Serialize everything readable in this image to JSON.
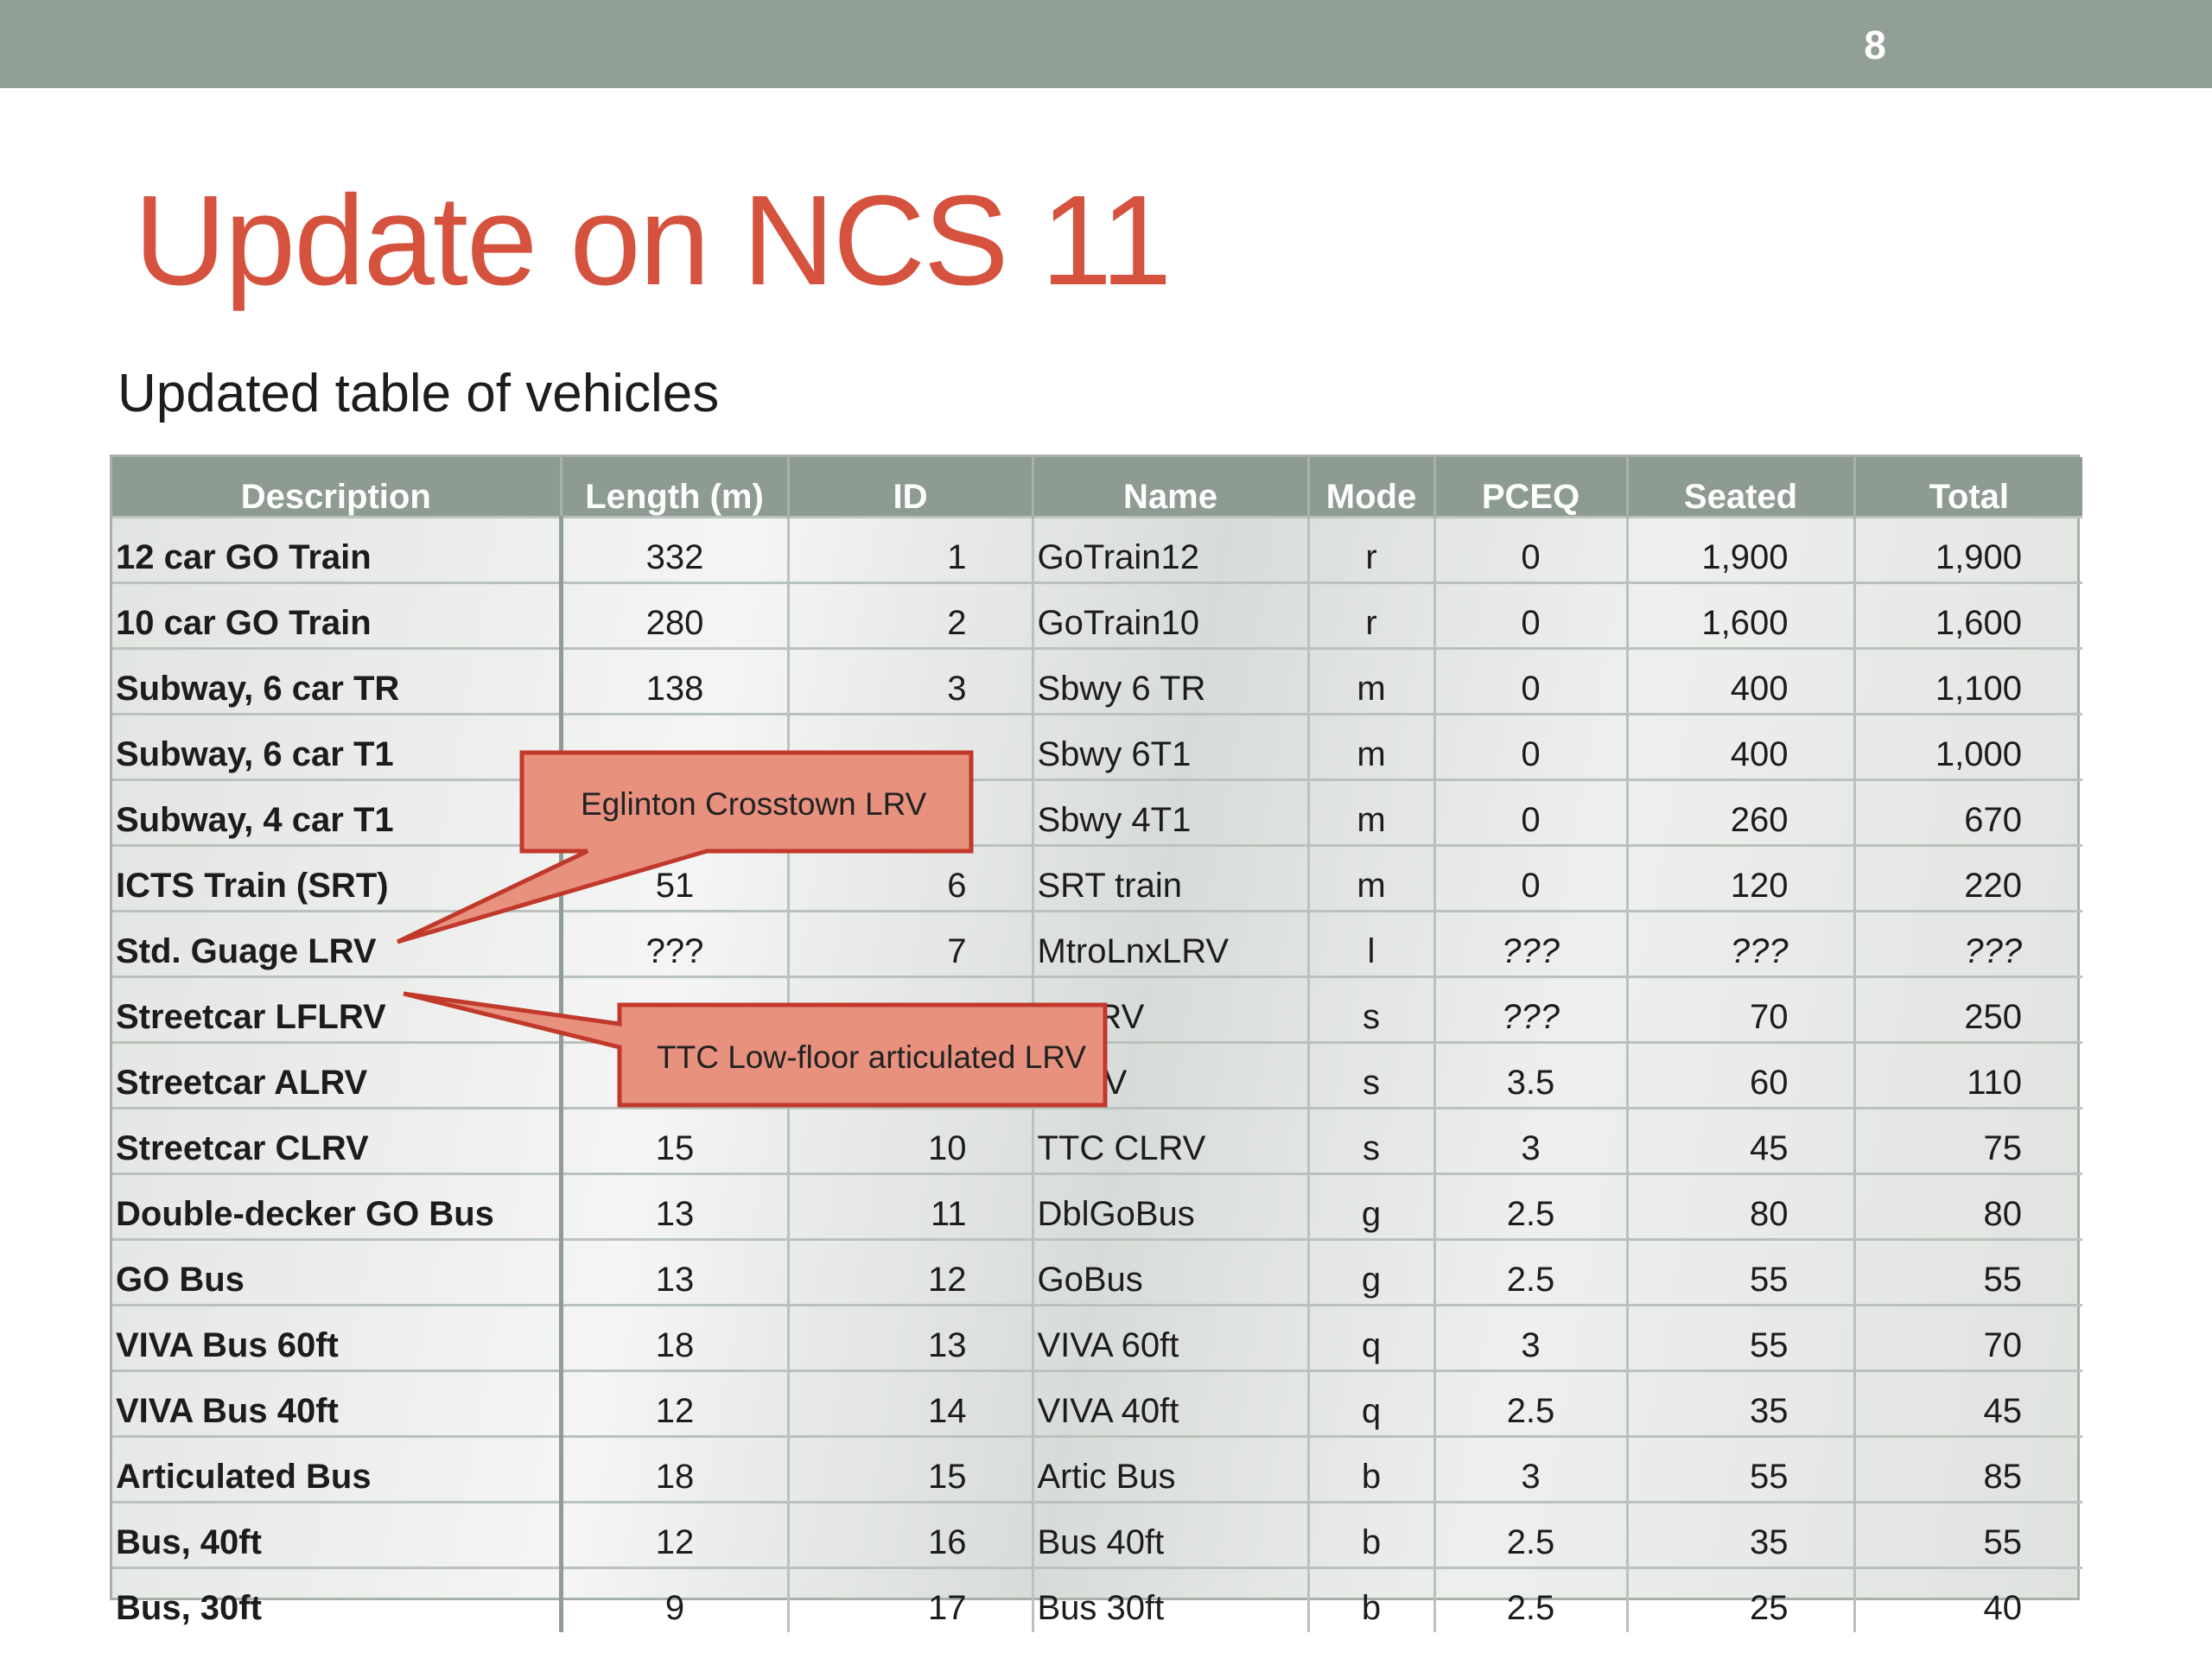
{
  "slide": {
    "page_number": "8",
    "title": "Update on NCS 11",
    "subtitle": "Updated table of vehicles"
  },
  "table": {
    "headers": [
      "Description",
      "Length (m)",
      "ID",
      "Name",
      "Mode",
      "PCEQ",
      "Seated",
      "Total"
    ],
    "rows": [
      [
        "12 car GO Train",
        "332",
        "1",
        "GoTrain12",
        "r",
        "0",
        "1,900",
        "1,900"
      ],
      [
        "10 car GO Train",
        "280",
        "2",
        "GoTrain10",
        "r",
        "0",
        "1,600",
        "1,600"
      ],
      [
        "Subway, 6 car TR",
        "138",
        "3",
        "Sbwy 6 TR",
        "m",
        "0",
        "400",
        "1,100"
      ],
      [
        "Subway, 6 car T1",
        "",
        "",
        "Sbwy 6T1",
        "m",
        "0",
        "400",
        "1,000"
      ],
      [
        "Subway, 4 car T1",
        "",
        "",
        "Sbwy 4T1",
        "m",
        "0",
        "260",
        "670"
      ],
      [
        "ICTS Train (SRT)",
        "51",
        "6",
        "SRT train",
        "m",
        "0",
        "120",
        "220"
      ],
      [
        "Std. Guage LRV",
        "???",
        "7",
        "MtroLnxLRV",
        "l",
        "???",
        "???",
        "???"
      ],
      [
        "Streetcar  LFLRV",
        "",
        "",
        "LFLRV",
        "s",
        "???",
        "70",
        "250"
      ],
      [
        "Streetcar ALRV",
        "",
        "",
        "ALRV",
        "s",
        "3.5",
        "60",
        "110"
      ],
      [
        "Streetcar CLRV",
        "15",
        "10",
        "TTC CLRV",
        "s",
        "3",
        "45",
        "75"
      ],
      [
        "Double-decker GO Bus",
        "13",
        "11",
        "DblGoBus",
        "g",
        "2.5",
        "80",
        "80"
      ],
      [
        "GO Bus",
        "13",
        "12",
        "GoBus",
        "g",
        "2.5",
        "55",
        "55"
      ],
      [
        "VIVA Bus 60ft",
        "18",
        "13",
        "VIVA 60ft",
        "q",
        "3",
        "55",
        "70"
      ],
      [
        "VIVA Bus 40ft",
        "12",
        "14",
        "VIVA 40ft",
        "q",
        "2.5",
        "35",
        "45"
      ],
      [
        "Articulated Bus",
        "18",
        "15",
        "Artic Bus",
        "b",
        "3",
        "55",
        "85"
      ],
      [
        "Bus, 40ft",
        "12",
        "16",
        "Bus 40ft",
        "b",
        "2.5",
        "35",
        "55"
      ],
      [
        "Bus, 30ft",
        "9",
        "17",
        "Bus 30ft",
        "b",
        "2.5",
        "25",
        "40"
      ]
    ]
  },
  "callouts": {
    "eglinton": "Eglinton Crosstown LRV",
    "ttc": "TTC Low-floor articulated LRV",
    "fill_color": "#e8917f",
    "stroke_color": "#c0392b"
  }
}
